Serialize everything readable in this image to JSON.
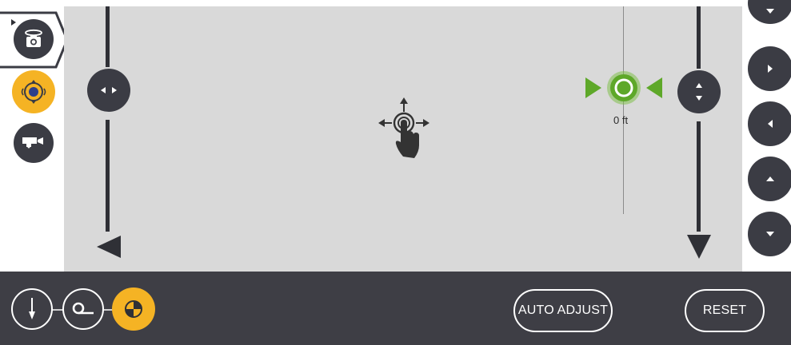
{
  "viewport": {
    "distance_readout": "0 ft"
  },
  "toolbar": {
    "auto_adjust_label": "AUTO ADJUST",
    "reset_label": "RESET"
  },
  "icons": {
    "sidebar": [
      "camera-rotate-icon",
      "target-move-icon",
      "video-camera-icon"
    ],
    "right_nudge": [
      "chevron-down-icon",
      "chevron-right-icon",
      "chevron-left-icon",
      "chevron-up-icon",
      "chevron-down-icon"
    ],
    "bottom_modes": [
      "plumb-bob-icon",
      "tape-measure-icon",
      "target-crosshair-icon"
    ]
  },
  "colors": {
    "accent_yellow": "#f5b324",
    "marker_green": "#5ea829",
    "bar_dark": "#3e3e45",
    "canvas_gray": "#d9d9d9"
  }
}
